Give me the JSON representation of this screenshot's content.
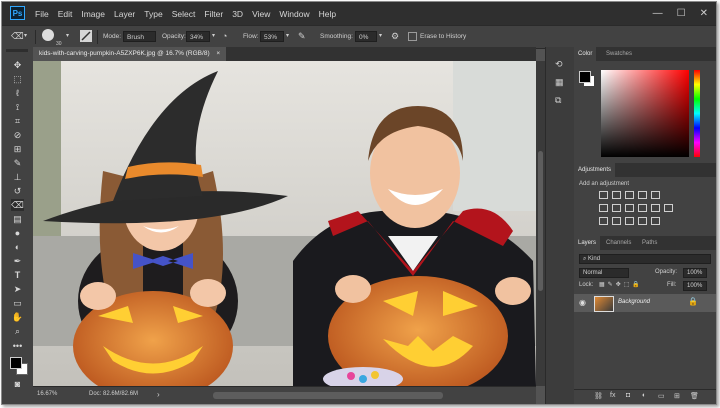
{
  "app": {
    "logo": "Ps"
  },
  "menu": [
    "File",
    "Edit",
    "Image",
    "Layer",
    "Type",
    "Select",
    "Filter",
    "3D",
    "View",
    "Window",
    "Help"
  ],
  "window_controls": {
    "minimize": "—",
    "maximize": "☐",
    "close": "✕"
  },
  "options": {
    "size": "30",
    "mode_label": "Mode:",
    "mode_value": "Brush",
    "opacity_label": "Opacity:",
    "opacity_value": "34%",
    "flow_label": "Flow:",
    "flow_value": "53%",
    "smoothing_label": "Smoothing:",
    "smoothing_value": "0%",
    "erase_history": "Erase to History"
  },
  "document": {
    "tab_title": "kids-with-carving-pumpkin-A5ZXP6K.jpg @ 16.7% (RGB/8)",
    "tab_close": "×"
  },
  "status": {
    "zoom": "16.67%",
    "doc": "Doc: 82.6M/82.6M",
    "arrow": "›"
  },
  "panels": {
    "color_tabs": [
      "Color",
      "Swatches"
    ],
    "adjustments_title": "Adjustments",
    "add_adjustment": "Add an adjustment",
    "layer_tabs": [
      "Layers",
      "Channels",
      "Paths"
    ],
    "kind_filter": "Kind",
    "blend_mode": "Normal",
    "opacity_label": "Opacity:",
    "opacity_value": "100%",
    "lock_label": "Lock:",
    "fill_label": "Fill:",
    "fill_value": "100%",
    "layer_name": "Background"
  },
  "colors": {
    "accent": "#31a8ff",
    "panel": "#424242",
    "canvasbg": "#535353"
  },
  "icons": [
    "move-icon",
    "marquee-icon",
    "lasso-icon",
    "quick-select-icon",
    "crop-icon",
    "eyedropper-icon",
    "healing-icon",
    "brush-icon",
    "stamp-icon",
    "history-brush-icon",
    "eraser-icon",
    "gradient-icon",
    "blur-icon",
    "dodge-icon",
    "pen-icon",
    "type-icon",
    "path-select-icon",
    "rectangle-icon",
    "hand-icon",
    "zoom-icon",
    "more-icon"
  ]
}
